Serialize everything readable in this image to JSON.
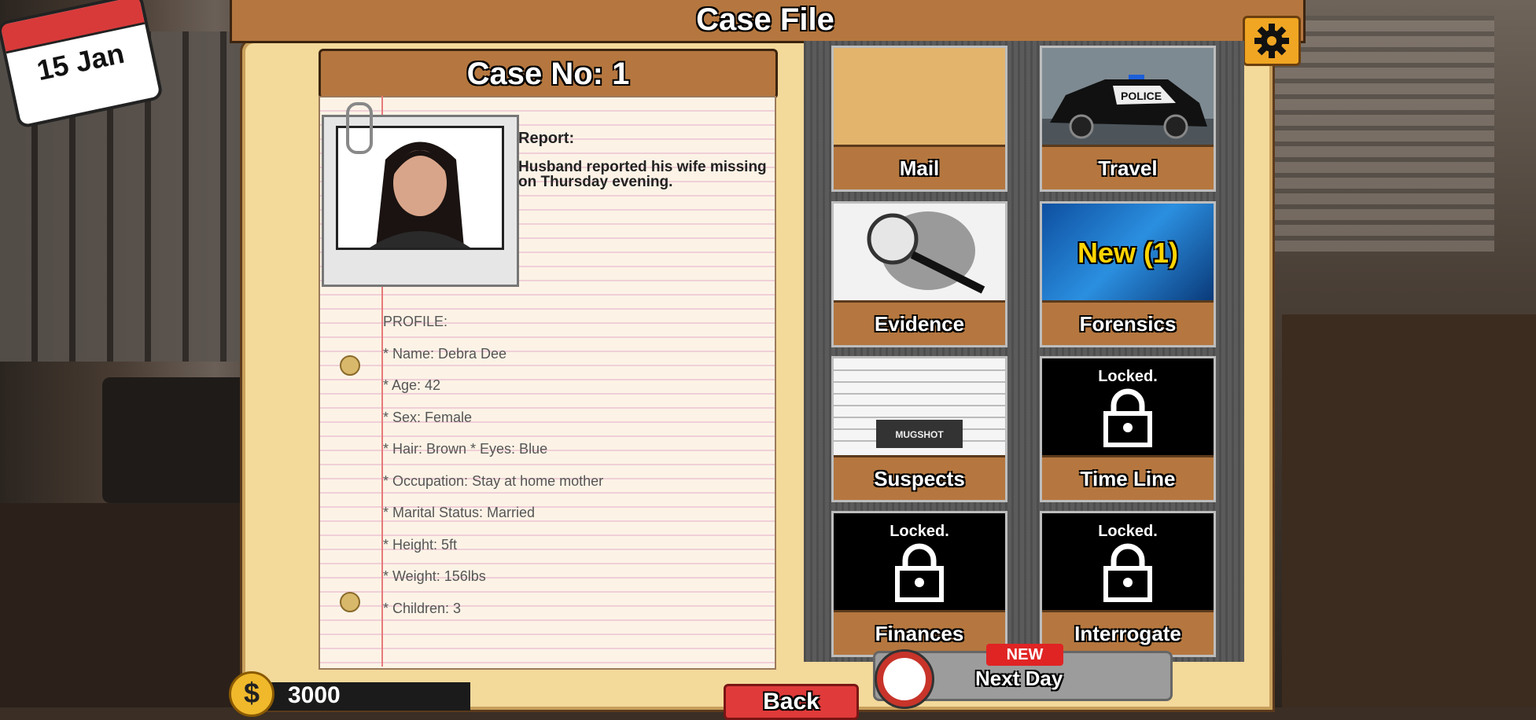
{
  "header": {
    "title": "Case File",
    "settings_icon": "gear-icon"
  },
  "date": {
    "label": "15 Jan"
  },
  "case": {
    "number_label": "Case No: 1",
    "report_label": "Report:",
    "report_text": "Husband reported his wife missing on Thursday evening.",
    "profile_title": "PROFILE:",
    "profile": [
      "* Name: Debra Dee",
      "* Age: 42",
      "* Sex: Female",
      "* Hair:  Brown  * Eyes: Blue",
      "* Occupation: Stay at home mother",
      "* Marital Status: Married",
      "* Height: 5ft",
      "* Weight: 156lbs",
      "* Children: 3"
    ]
  },
  "tiles": {
    "mail": {
      "label": "Mail"
    },
    "travel": {
      "label": "Travel"
    },
    "evidence": {
      "label": "Evidence"
    },
    "forensics": {
      "label": "Forensics",
      "badge": "New (1)"
    },
    "suspects": {
      "label": "Suspects",
      "sign": "MUGSHOT"
    },
    "timeline": {
      "label": "Time Line",
      "status": "Locked."
    },
    "finances": {
      "label": "Finances",
      "status": "Locked."
    },
    "interrogate": {
      "label": "Interrogate",
      "status": "Locked."
    }
  },
  "next_day": {
    "label": "Next Day",
    "badge": "NEW"
  },
  "money": {
    "symbol": "$",
    "amount": "3000"
  },
  "back": {
    "label": "Back"
  },
  "police_car": {
    "text": "POLICE"
  },
  "colors": {
    "tile_brown": "#b5773f",
    "folder": "#f3d99a",
    "accent_red": "#e03a3a",
    "coin": "#f0b92c"
  }
}
